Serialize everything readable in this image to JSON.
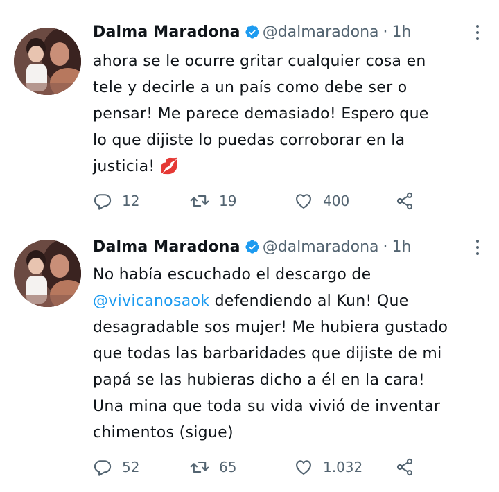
{
  "tweets": [
    {
      "name": "Dalma Maradona",
      "handle": "@dalmaradona",
      "separator": "·",
      "time": "1h",
      "text_lines": [
        "ahora se le ocurre gritar cualquier cosa en",
        "tele y decirle a un país como debe ser o",
        "pensar! Me parece demasiado! Espero que",
        "lo que dijiste lo puedas corroborar en la",
        "justicia!"
      ],
      "emoji": "💋",
      "replies": "12",
      "retweets": "19",
      "likes": "400"
    },
    {
      "name": "Dalma Maradona",
      "handle": "@dalmaradona",
      "separator": "·",
      "time": "1h",
      "line1": "No había escuchado el descargo de",
      "mention": "@vivicanosaok",
      "line2_rest": " defendiendo al Kun! Que",
      "text_rest": "desagradable sos mujer! Me hubiera gustado\nque todas las barbaridades que dijiste de mi\npapá se las hubieras dicho a él en la cara!\nUna mina que toda su vida vivió de inventar\nchimentos (sigue)",
      "replies": "52",
      "retweets": "65",
      "likes": "1.032"
    }
  ],
  "colors": {
    "text": "#0f1419",
    "secondary": "#536471",
    "link": "#1d9bf0",
    "verified": "#1d9bf0",
    "divider": "#eff3f4"
  },
  "icons": [
    "verified-badge-icon",
    "more-options-icon",
    "reply-icon",
    "retweet-icon",
    "like-icon",
    "share-icon"
  ]
}
